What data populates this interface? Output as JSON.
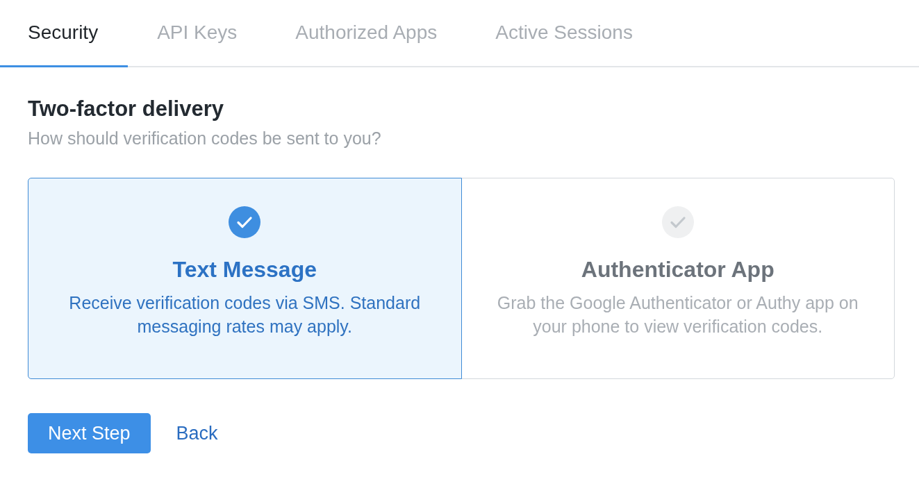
{
  "tabs": [
    {
      "label": "Security",
      "selected": true
    },
    {
      "label": "API Keys",
      "selected": false
    },
    {
      "label": "Authorized Apps",
      "selected": false
    },
    {
      "label": "Active Sessions",
      "selected": false
    }
  ],
  "heading": "Two-factor delivery",
  "subtitle": "How should verification codes be sent to you?",
  "options": [
    {
      "title": "Text Message",
      "description": "Receive verification codes via SMS. Standard messaging rates may apply.",
      "selected": true
    },
    {
      "title": "Authenticator App",
      "description": "Grab the Google Authenticator or Authy app on your phone to view verification codes.",
      "selected": false
    }
  ],
  "actions": [
    {
      "kind": "primary",
      "label": "Next Step"
    },
    {
      "kind": "link",
      "label": "Back"
    }
  ]
}
